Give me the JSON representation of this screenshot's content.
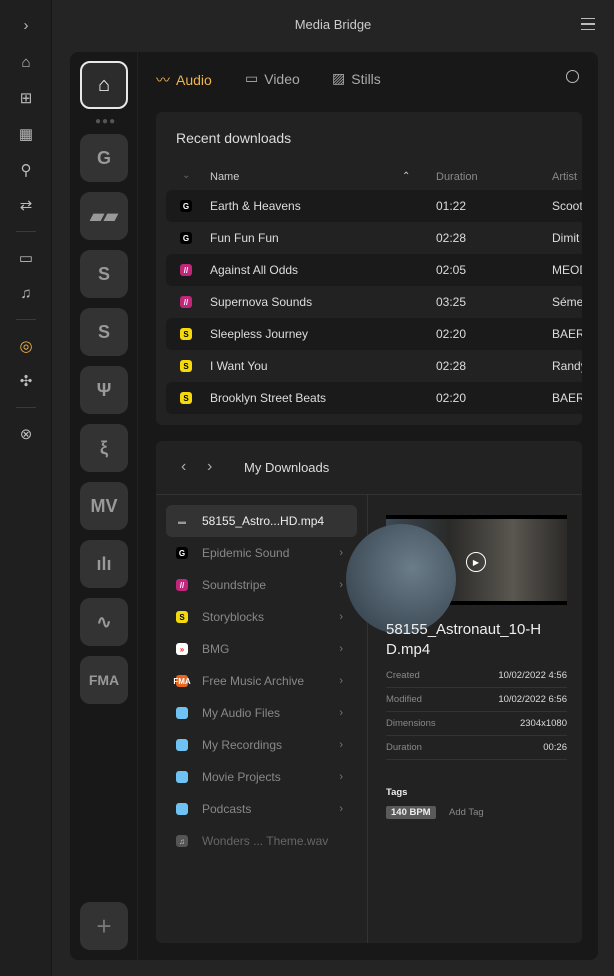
{
  "app": {
    "title": "Media Bridge"
  },
  "rail": {
    "icons": [
      "chevron-right-icon",
      "home-icon",
      "add-grid-icon",
      "grid-icon",
      "search-icon",
      "transfer-icon",
      "stack-icon",
      "playlist-icon",
      "media-bridge-icon",
      "puzzle-icon",
      "help-lifebuoy-icon"
    ],
    "active_color": "#f0b44c"
  },
  "sources": [
    "Epidemic Sound",
    "Soundstripe",
    "Storyblocks",
    "Splice",
    "Artlist",
    "Musicbed",
    "Musicvine",
    "Audio Network",
    "Audiio",
    "FMA"
  ],
  "tabs": [
    {
      "label": "Audio",
      "active": true
    },
    {
      "label": "Video"
    },
    {
      "label": "Stills"
    }
  ],
  "accent": "#f0b44c",
  "recent": {
    "title": "Recent downloads",
    "columns": [
      "Name",
      "Duration",
      "Artist"
    ],
    "rows": [
      {
        "name": "Earth & Heavens",
        "duration": "01:22",
        "artist": "Scoot",
        "src": "epidemic"
      },
      {
        "name": "Fun Fun Fun",
        "duration": "02:28",
        "artist": "Dimit",
        "src": "epidemic"
      },
      {
        "name": "Against All Odds",
        "duration": "02:05",
        "artist": "MEOD",
        "src": "soundstripe"
      },
      {
        "name": "Supernova Sounds",
        "duration": "03:25",
        "artist": "Séme",
        "src": "soundstripe"
      },
      {
        "name": "Sleepless Journey",
        "duration": "02:20",
        "artist": "BAER",
        "src": "storyblocks"
      },
      {
        "name": "I Want You",
        "duration": "02:28",
        "artist": "Randy",
        "src": "storyblocks"
      },
      {
        "name": "Brooklyn Street Beats",
        "duration": "02:20",
        "artist": "BAER",
        "src": "storyblocks"
      }
    ]
  },
  "downloads": {
    "title": "My Downloads",
    "items": [
      {
        "label": "58155_Astro...HD.mp4",
        "type": "video",
        "selected": true
      },
      {
        "label": "Epidemic Sound",
        "type": "epidemic",
        "folder": true
      },
      {
        "label": "Soundstripe",
        "type": "soundstripe",
        "folder": true
      },
      {
        "label": "Storyblocks",
        "type": "storyblocks",
        "folder": true
      },
      {
        "label": "BMG",
        "type": "bmg",
        "folder": true
      },
      {
        "label": "Free Music Archive",
        "type": "fma",
        "folder": true
      },
      {
        "label": "My Audio Files",
        "type": "folder",
        "folder": true
      },
      {
        "label": "My Recordings",
        "type": "folder",
        "folder": true
      },
      {
        "label": "Movie Projects",
        "type": "folder",
        "folder": true
      },
      {
        "label": "Podcasts",
        "type": "folder",
        "folder": true
      },
      {
        "label": "Wonders ... Theme.wav",
        "type": "audio"
      }
    ],
    "preview": {
      "filename": "58155_Astronaut_10-HD.mp4",
      "meta": [
        {
          "k": "Created",
          "v": "10/02/2022 4:56"
        },
        {
          "k": "Modified",
          "v": "10/02/2022 6:56"
        },
        {
          "k": "Dimensions",
          "v": "2304x1080"
        },
        {
          "k": "Duration",
          "v": "00:26"
        }
      ],
      "tags_label": "Tags",
      "tags": [
        "140 BPM"
      ],
      "add_tag": "Add Tag"
    }
  }
}
